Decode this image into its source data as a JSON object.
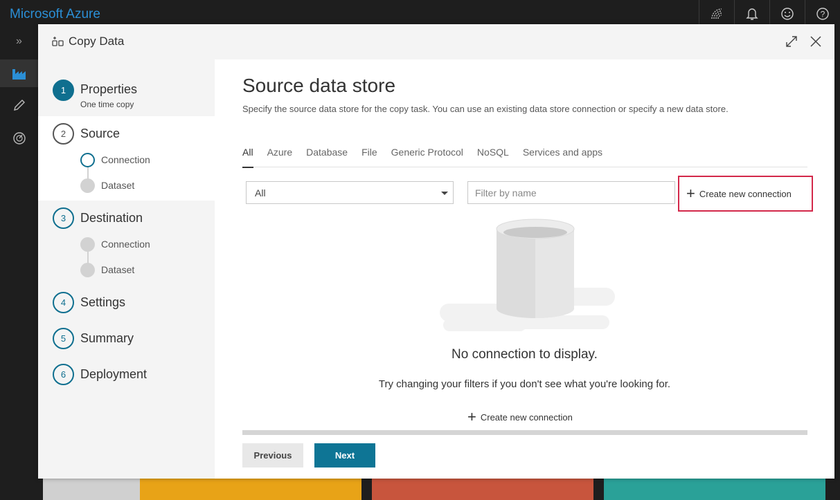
{
  "app": {
    "brand": "Microsoft Azure"
  },
  "topbar": {
    "icons": [
      "wifi-icon",
      "bell-icon",
      "smiley-icon",
      "help-icon"
    ]
  },
  "rail": {
    "expand": "»",
    "items": [
      "factory-icon",
      "pencil-icon",
      "gauge-icon"
    ]
  },
  "dialog": {
    "title": "Copy Data"
  },
  "steps": [
    {
      "num": "1",
      "label": "Properties",
      "sub": "One time copy"
    },
    {
      "num": "2",
      "label": "Source",
      "substeps": [
        "Connection",
        "Dataset"
      ]
    },
    {
      "num": "3",
      "label": "Destination",
      "substeps": [
        "Connection",
        "Dataset"
      ]
    },
    {
      "num": "4",
      "label": "Settings"
    },
    {
      "num": "5",
      "label": "Summary"
    },
    {
      "num": "6",
      "label": "Deployment"
    }
  ],
  "panel": {
    "title": "Source data store",
    "description": "Specify the source data store for the copy task. You can use an existing data store connection or specify a new data store.",
    "tabs": [
      "All",
      "Azure",
      "Database",
      "File",
      "Generic Protocol",
      "NoSQL",
      "Services and apps"
    ],
    "select_value": "All",
    "filter_placeholder": "Filter by name",
    "create_connection": "Create new connection",
    "empty_title": "No connection to display.",
    "empty_hint": "Try changing your filters if you don't see what you're looking for.",
    "create_connection_bottom": "Create new connection"
  },
  "footer": {
    "previous": "Previous",
    "next": "Next"
  },
  "colors": {
    "accent": "#0e7595",
    "highlight_border": "#d3284a",
    "brand": "#2b8fd6"
  }
}
